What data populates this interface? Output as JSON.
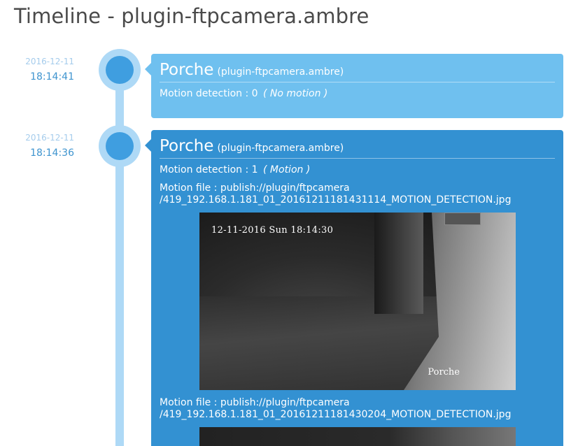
{
  "page": {
    "title": "Timeline - plugin-ftpcamera.ambre"
  },
  "events": [
    {
      "date": "2016-12-11",
      "time": "18:14:41",
      "name": "Porche",
      "source": "(plugin-ftpcamera.ambre)",
      "detection_label": "Motion detection : 0",
      "detection_state": "( No motion )"
    },
    {
      "date": "2016-12-11",
      "time": "18:14:36",
      "name": "Porche",
      "source": "(plugin-ftpcamera.ambre)",
      "detection_label": "Motion detection : 1",
      "detection_state": "( Motion )",
      "files": [
        {
          "label_line1": "Motion file : publish://plugin/ftpcamera",
          "label_line2": "/419_192.168.1.181_01_20161211181431114_MOTION_DETECTION.jpg",
          "overlay_timestamp": "12-11-2016 Sun 18:14:30",
          "overlay_camera": "Porche"
        },
        {
          "label_line1": "Motion file : publish://plugin/ftpcamera",
          "label_line2": "/419_192.168.1.181_01_20161211181430204_MOTION_DETECTION.jpg"
        }
      ]
    }
  ],
  "colors": {
    "card_no_motion": "#6fc0ef",
    "card_motion": "#3391d2",
    "timeline": "#aed9f6",
    "marker": "#3f9ee0"
  },
  "icons": {
    "marker": "timeline-marker-dot"
  }
}
